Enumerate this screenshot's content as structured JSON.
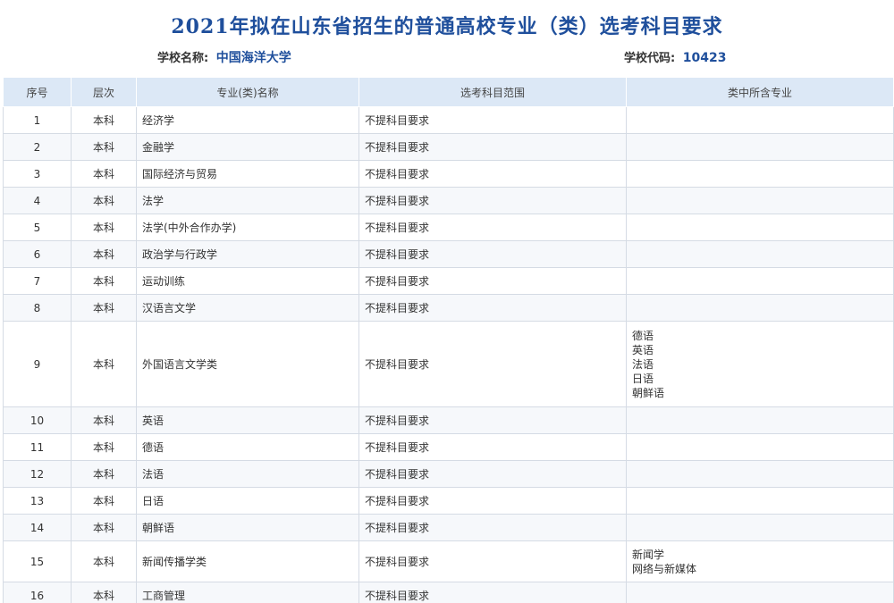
{
  "header": {
    "title": "2021年拟在山东省招生的普通高校专业（类）选考科目要求",
    "school_label": "学校名称:",
    "school_name": "中国海洋大学",
    "code_label": "学校代码:",
    "school_code": "10423"
  },
  "table": {
    "columns": [
      "序号",
      "层次",
      "专业(类)名称",
      "选考科目范围",
      "类中所含专业"
    ],
    "rows": [
      {
        "no": "1",
        "level": "本科",
        "major": "经济学",
        "range": "不提科目要求",
        "subs": []
      },
      {
        "no": "2",
        "level": "本科",
        "major": "金融学",
        "range": "不提科目要求",
        "subs": []
      },
      {
        "no": "3",
        "level": "本科",
        "major": "国际经济与贸易",
        "range": "不提科目要求",
        "subs": []
      },
      {
        "no": "4",
        "level": "本科",
        "major": "法学",
        "range": "不提科目要求",
        "subs": []
      },
      {
        "no": "5",
        "level": "本科",
        "major": "法学(中外合作办学)",
        "range": "不提科目要求",
        "subs": []
      },
      {
        "no": "6",
        "level": "本科",
        "major": "政治学与行政学",
        "range": "不提科目要求",
        "subs": []
      },
      {
        "no": "7",
        "level": "本科",
        "major": "运动训练",
        "range": "不提科目要求",
        "subs": []
      },
      {
        "no": "8",
        "level": "本科",
        "major": "汉语言文学",
        "range": "不提科目要求",
        "subs": []
      },
      {
        "no": "9",
        "level": "本科",
        "major": "外国语言文学类",
        "range": "不提科目要求",
        "subs": [
          "德语",
          "英语",
          "法语",
          "日语",
          "朝鲜语"
        ]
      },
      {
        "no": "10",
        "level": "本科",
        "major": "英语",
        "range": "不提科目要求",
        "subs": []
      },
      {
        "no": "11",
        "level": "本科",
        "major": "德语",
        "range": "不提科目要求",
        "subs": []
      },
      {
        "no": "12",
        "level": "本科",
        "major": "法语",
        "range": "不提科目要求",
        "subs": []
      },
      {
        "no": "13",
        "level": "本科",
        "major": "日语",
        "range": "不提科目要求",
        "subs": []
      },
      {
        "no": "14",
        "level": "本科",
        "major": "朝鲜语",
        "range": "不提科目要求",
        "subs": []
      },
      {
        "no": "15",
        "level": "本科",
        "major": "新闻传播学类",
        "range": "不提科目要求",
        "subs": [
          "新闻学",
          "网络与新媒体"
        ]
      },
      {
        "no": "16",
        "level": "本科",
        "major": "工商管理",
        "range": "不提科目要求",
        "subs": []
      }
    ]
  }
}
